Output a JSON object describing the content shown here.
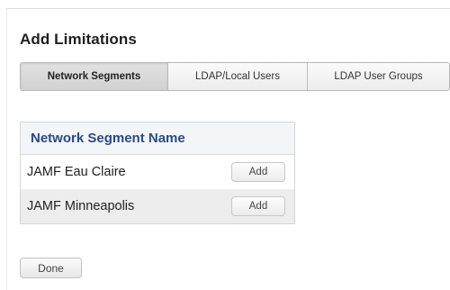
{
  "title": "Add Limitations",
  "tabs": [
    {
      "label": "Network Segments",
      "active": true
    },
    {
      "label": "LDAP/Local Users",
      "active": false
    },
    {
      "label": "LDAP User Groups",
      "active": false
    }
  ],
  "segment_table": {
    "header": "Network Segment Name",
    "rows": [
      {
        "name": "JAMF Eau Claire",
        "action_label": "Add"
      },
      {
        "name": "JAMF Minneapolis",
        "action_label": "Add"
      }
    ]
  },
  "done_label": "Done"
}
